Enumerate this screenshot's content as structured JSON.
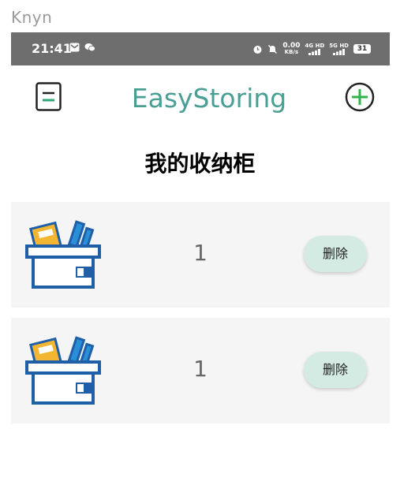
{
  "watermark": "Knyn",
  "status_bar": {
    "time": "21:41",
    "net_speed_value": "0.00",
    "net_speed_unit": "KB/s",
    "sim1_label": "4G HD",
    "sim2_label": "5G HD",
    "battery": "31",
    "icons": [
      "mail-icon",
      "wechat-icon",
      "alarm-icon",
      "mute-icon",
      "signal-icon",
      "battery-icon"
    ]
  },
  "header": {
    "title": "EasyStoring",
    "menu_icon": "menu-icon",
    "add_icon": "add-circle-icon",
    "accent_color": "#4a9f95",
    "add_color": "#2fb34a"
  },
  "section": {
    "title": "我的收纳柜"
  },
  "cabinets": [
    {
      "count": "1",
      "delete_label": "删除",
      "icon": "storage-box-icon"
    },
    {
      "count": "1",
      "delete_label": "删除",
      "icon": "storage-box-icon"
    }
  ],
  "colors": {
    "row_bg": "#f5f5f5",
    "delete_bg": "#d4ebe3",
    "box_blue": "#1f5fa8",
    "box_yellow": "#f2b632",
    "box_light_blue": "#2a8fd6"
  }
}
